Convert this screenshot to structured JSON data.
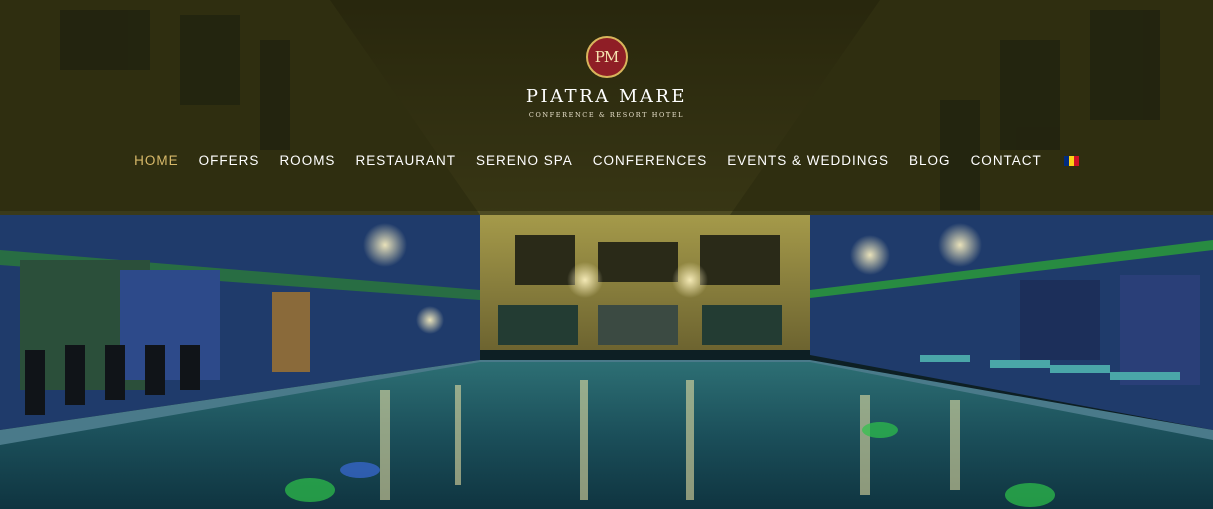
{
  "brand": {
    "emblem": "PM",
    "name": "PIATRA MARE",
    "tagline": "CONFERENCE & RESORT HOTEL"
  },
  "nav": {
    "items": [
      {
        "label": "HOME",
        "active": true
      },
      {
        "label": "OFFERS"
      },
      {
        "label": "ROOMS"
      },
      {
        "label": "RESTAURANT"
      },
      {
        "label": "SERENO SPA"
      },
      {
        "label": "CONFERENCES"
      },
      {
        "label": "EVENTS & WEDDINGS"
      },
      {
        "label": "BLOG"
      },
      {
        "label": "CONTACT"
      }
    ],
    "language_icon": "romania-flag-icon"
  },
  "colors": {
    "active_nav": "#d8b96a",
    "nav": "#ffffff",
    "emblem_bg": "#8f1e26",
    "emblem_border": "#d8b55c",
    "flag": [
      "#002b7f",
      "#fcd116",
      "#ce1126"
    ]
  }
}
